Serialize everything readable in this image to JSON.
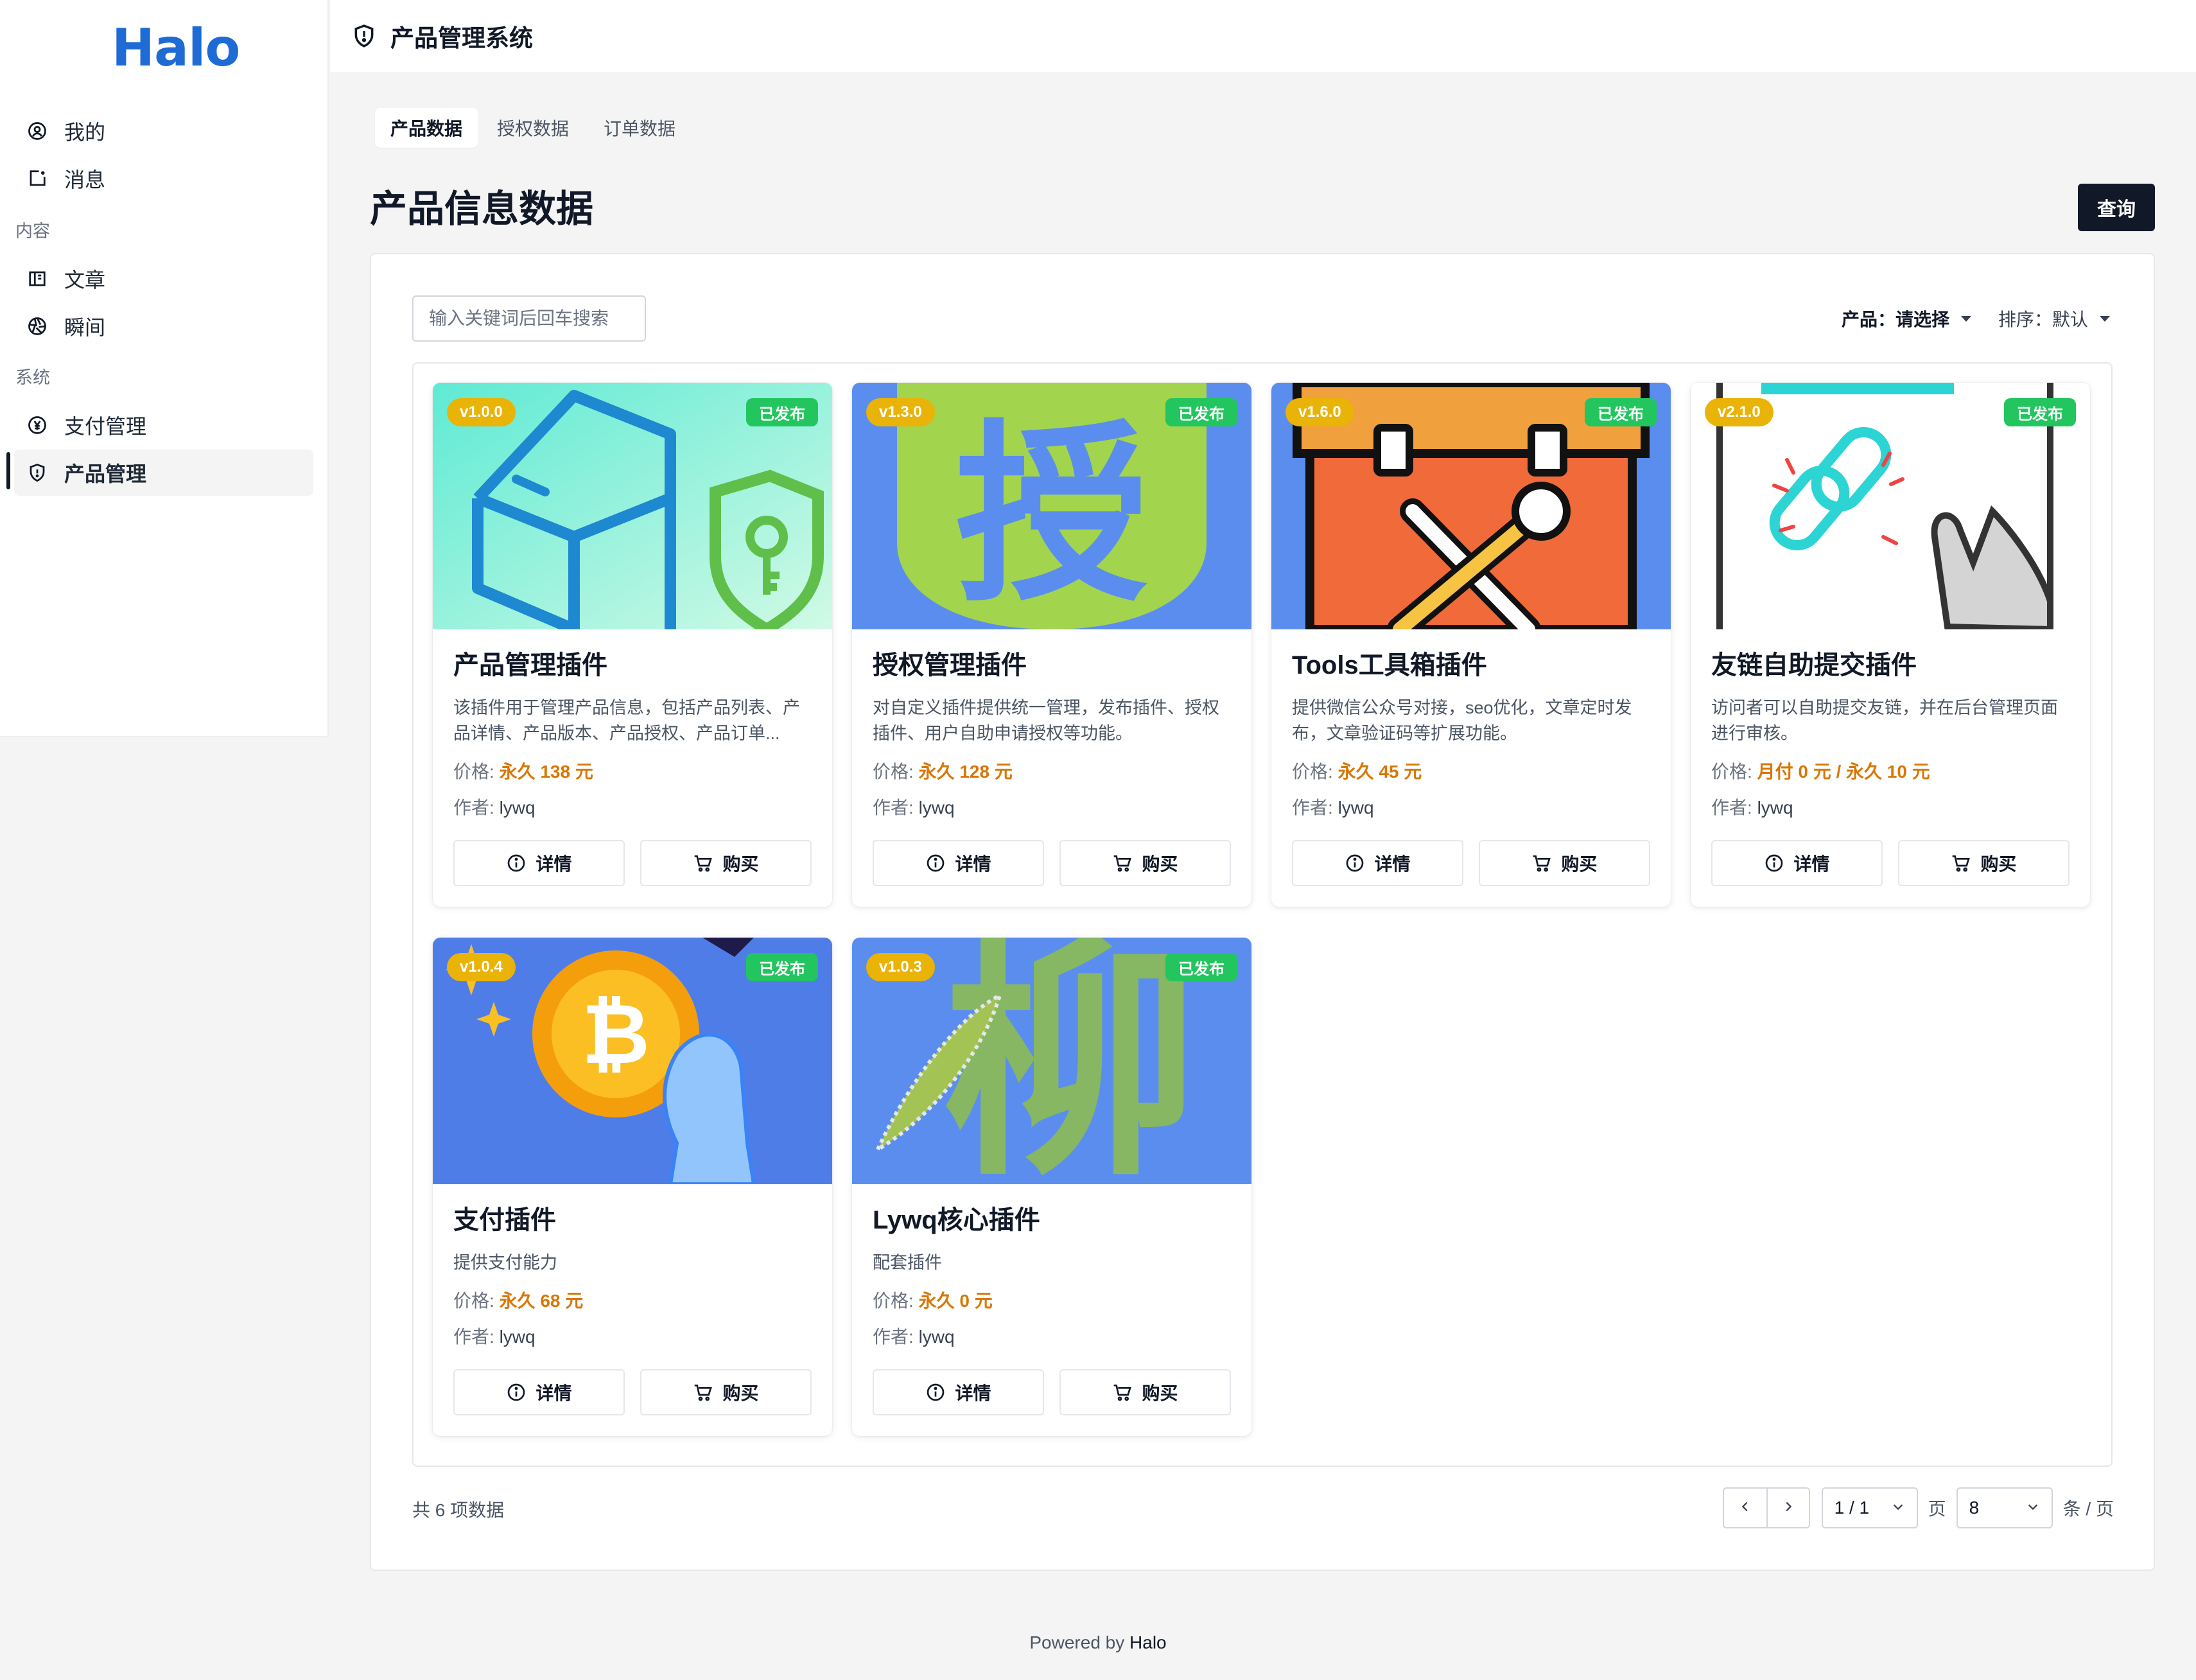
{
  "sidebar": {
    "logo": "Halo",
    "items_top": [
      {
        "label": "我的",
        "icon": "user-circle-icon"
      },
      {
        "label": "消息",
        "icon": "message-square-icon"
      }
    ],
    "group_content": "内容",
    "items_content": [
      {
        "label": "文章",
        "icon": "book-icon"
      },
      {
        "label": "瞬间",
        "icon": "aperture-icon"
      }
    ],
    "group_system": "系统",
    "items_system": [
      {
        "label": "支付管理",
        "icon": "currency-yen-icon"
      },
      {
        "label": "产品管理",
        "icon": "shield-icon",
        "active": true
      }
    ]
  },
  "header": {
    "title": "产品管理系统",
    "icon": "shield-icon"
  },
  "tabs": [
    {
      "label": "产品数据",
      "active": true
    },
    {
      "label": "授权数据",
      "active": false
    },
    {
      "label": "订单数据",
      "active": false
    }
  ],
  "page": {
    "heading": "产品信息数据",
    "query_label": "查询"
  },
  "toolbar": {
    "search_placeholder": "输入关键词后回车搜索",
    "product_filter_label": "产品：",
    "product_filter_value": "请选择",
    "sort_label": "排序：",
    "sort_value": "默认"
  },
  "cards": [
    {
      "version": "v1.0.0",
      "status": "已发布",
      "title": "产品管理插件",
      "description": "该插件用于管理产品信息，包括产品列表、产品详情、产品版本、产品授权、产品订单...",
      "price_label": "价格:",
      "price": "永久 138 元",
      "author_label": "作者:",
      "author": "lywq",
      "detail_label": "详情",
      "buy_label": "购买"
    },
    {
      "version": "v1.3.0",
      "status": "已发布",
      "title": "授权管理插件",
      "description": "对自定义插件提供统一管理，发布插件、授权插件、用户自助申请授权等功能。",
      "price_label": "价格:",
      "price": "永久 128 元",
      "author_label": "作者:",
      "author": "lywq",
      "detail_label": "详情",
      "buy_label": "购买",
      "image_text": "授"
    },
    {
      "version": "v1.6.0",
      "status": "已发布",
      "title": "Tools工具箱插件",
      "description": "提供微信公众号对接，seo优化，文章定时发布，文章验证码等扩展功能。",
      "price_label": "价格:",
      "price": "永久 45 元",
      "author_label": "作者:",
      "author": "lywq",
      "detail_label": "详情",
      "buy_label": "购买"
    },
    {
      "version": "v2.1.0",
      "status": "已发布",
      "title": "友链自助提交插件",
      "description": "访问者可以自助提交友链，并在后台管理页面进行审核。",
      "price_label": "价格:",
      "price": "月付 0 元 / 永久 10 元",
      "author_label": "作者:",
      "author": "lywq",
      "detail_label": "详情",
      "buy_label": "购买"
    },
    {
      "version": "v1.0.4",
      "status": "已发布",
      "title": "支付插件",
      "description": "提供支付能力",
      "price_label": "价格:",
      "price": "永久 68 元",
      "author_label": "作者:",
      "author": "lywq",
      "detail_label": "详情",
      "buy_label": "购买"
    },
    {
      "version": "v1.0.3",
      "status": "已发布",
      "title": "Lywq核心插件",
      "description": "配套插件",
      "price_label": "价格:",
      "price": "永久 0 元",
      "author_label": "作者:",
      "author": "lywq",
      "detail_label": "详情",
      "buy_label": "购买",
      "image_text": "柳"
    }
  ],
  "pagination": {
    "total_text": "共 6 项数据",
    "page_value": "1 / 1",
    "page_unit": "页",
    "size_value": "8",
    "size_unit": "条 / 页"
  },
  "footer": {
    "prefix": "Powered by",
    "brand": "Halo"
  },
  "colors": {
    "brand": "#1e6bd6",
    "version_badge": "#eab308",
    "published_badge": "#22c55e",
    "price": "#d97706",
    "primary_button": "#111827"
  }
}
